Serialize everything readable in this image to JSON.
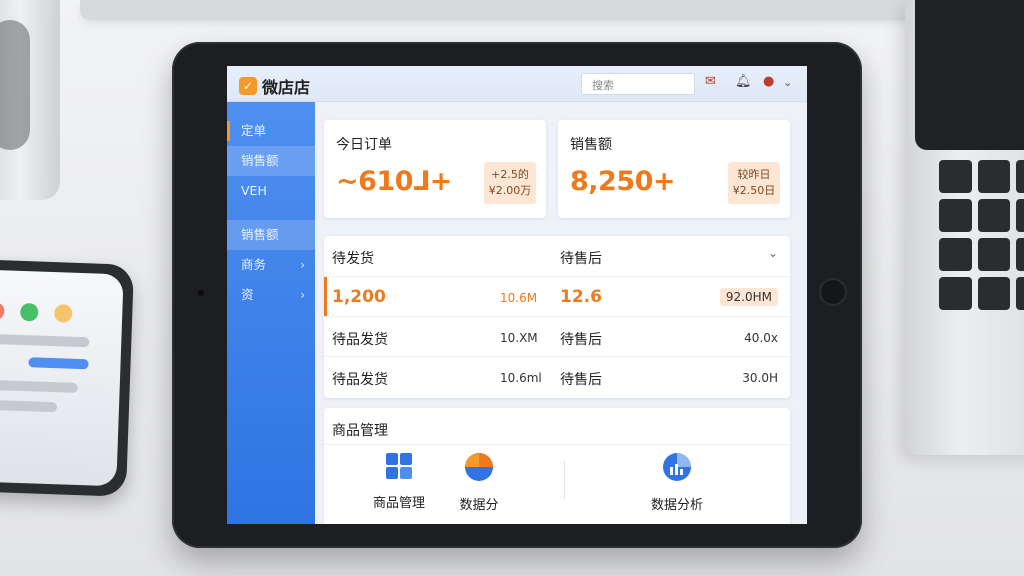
{
  "header": {
    "logo_text": "微店店",
    "search_placeholder": "搜索"
  },
  "sidebar": {
    "items": [
      {
        "label": "定单"
      },
      {
        "label": "销售额"
      },
      {
        "label": "VEH"
      },
      {
        "label": "销售额"
      },
      {
        "label": "商务"
      },
      {
        "label": "资"
      }
    ]
  },
  "kpi": {
    "orders": {
      "title": "今日订单",
      "value": "~610⅃+",
      "mini_top": "+2.5的",
      "mini_bottom": "¥2.00万"
    },
    "sales": {
      "title": "销售额",
      "value": "8,250+",
      "mini_top": "较昨日",
      "mini_bottom": "¥2.50日"
    }
  },
  "table": {
    "head_left": "待发货",
    "head_right": "待售后",
    "rows": [
      {
        "left_label": "1,200",
        "left_value": "10.6M",
        "right_label": "12.6",
        "right_value": "92.0HM"
      },
      {
        "left_label": "待品发货",
        "left_value": "10.XM",
        "right_label": "待售后",
        "right_value": "40.0x"
      },
      {
        "left_label": "待品发货",
        "left_value": "10.6ml",
        "right_label": "待售后",
        "right_value": "30.0H"
      }
    ]
  },
  "products": {
    "title": "商品管理",
    "tools": [
      {
        "label": "商品管理",
        "icon": "grid-icon"
      },
      {
        "label": "数据分",
        "icon": "pie-chart-icon"
      },
      {
        "label": "数据分析",
        "icon": "analytics-icon"
      }
    ]
  },
  "colors": {
    "accent": "#ef7a1e",
    "sidebar": "#3a80e8"
  }
}
